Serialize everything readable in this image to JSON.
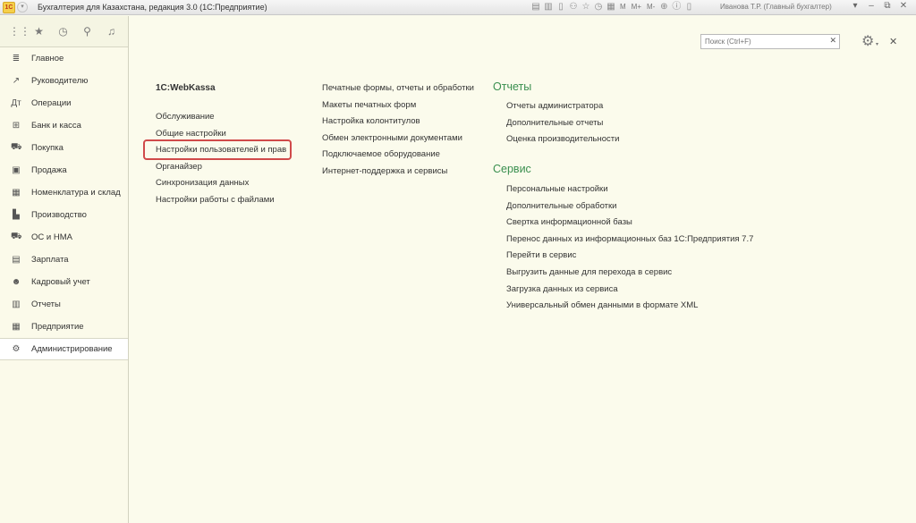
{
  "titlebar": {
    "logo": "1С",
    "title": "Бухгалтерия для Казахстана, редакция 3.0 (1С:Предприятие)",
    "tools": [
      "M",
      "M+",
      "M-"
    ],
    "user": "Иванова Т.Р. (Главный бухгалтер)"
  },
  "sidebar": {
    "items": [
      {
        "label": "Главное",
        "icon": "≣"
      },
      {
        "label": "Руководителю",
        "icon": "↗"
      },
      {
        "label": "Операции",
        "icon": "Дт"
      },
      {
        "label": "Банк и касса",
        "icon": "⊞"
      },
      {
        "label": "Покупка",
        "icon": "⛟"
      },
      {
        "label": "Продажа",
        "icon": "▣"
      },
      {
        "label": "Номенклатура и склад",
        "icon": "▦"
      },
      {
        "label": "Производство",
        "icon": "▙"
      },
      {
        "label": "ОС и НМА",
        "icon": "⛟"
      },
      {
        "label": "Зарплата",
        "icon": "▤"
      },
      {
        "label": "Кадровый учет",
        "icon": "☻"
      },
      {
        "label": "Отчеты",
        "icon": "▥"
      },
      {
        "label": "Предприятие",
        "icon": "▦"
      },
      {
        "label": "Администрирование",
        "icon": "⚙"
      }
    ]
  },
  "search": {
    "placeholder": "Поиск (Ctrl+F)"
  },
  "col1": {
    "header": "1C:WebKassa",
    "links": [
      "Обслуживание",
      "Общие настройки",
      "Настройки пользователей и прав",
      "Органайзер",
      "Синхронизация данных",
      "Настройки работы с файлами"
    ]
  },
  "col2": {
    "links": [
      "Печатные формы, отчеты и обработки",
      "Макеты печатных форм",
      "Настройка колонтитулов",
      "Обмен электронными документами",
      "Подключаемое оборудование",
      "Интернет-поддержка и сервисы"
    ]
  },
  "col3": {
    "reports_title": "Отчеты",
    "reports": [
      "Отчеты администратора",
      "Дополнительные отчеты",
      "Оценка производительности"
    ],
    "service_title": "Сервис",
    "service": [
      "Персональные настройки",
      "Дополнительные обработки",
      "Свертка информационной базы",
      "Перенос данных из информационных баз 1С:Предприятия 7.7",
      "Перейти в сервис",
      "Выгрузить данные для перехода в сервис",
      "Загрузка данных из сервиса",
      "Универсальный обмен данными в формате XML"
    ]
  },
  "colors": {
    "group_heading": "#3a8f4f",
    "highlight": "#d04a4a",
    "background": "#fbfbec"
  }
}
